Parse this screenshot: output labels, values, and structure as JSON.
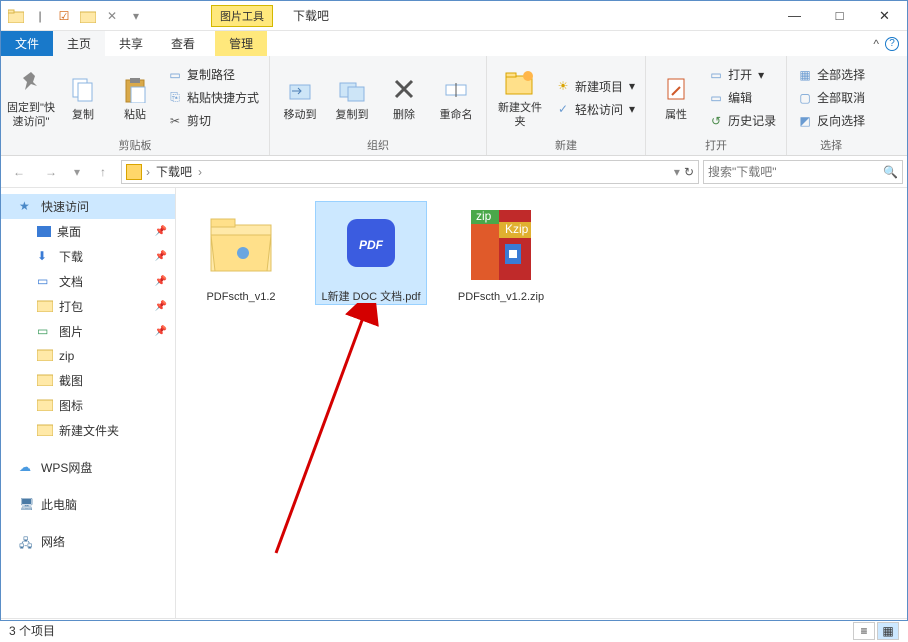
{
  "window": {
    "context_tab": "图片工具",
    "title": "下载吧",
    "minimize": "—",
    "maximize": "□",
    "close": "✕"
  },
  "tabs": {
    "file": "文件",
    "home": "主页",
    "share": "共享",
    "view": "查看",
    "manage": "管理"
  },
  "ribbon": {
    "clipboard": {
      "pin": "固定到\"快速访问\"",
      "copy": "复制",
      "paste": "粘贴",
      "copy_path": "复制路径",
      "paste_shortcut": "粘贴快捷方式",
      "cut": "剪切",
      "label": "剪贴板"
    },
    "organize": {
      "move_to": "移动到",
      "copy_to": "复制到",
      "delete": "删除",
      "rename": "重命名",
      "label": "组织"
    },
    "new": {
      "new_folder": "新建文件夹",
      "new_item": "新建项目",
      "easy_access": "轻松访问",
      "label": "新建"
    },
    "open": {
      "properties": "属性",
      "open": "打开",
      "edit": "编辑",
      "history": "历史记录",
      "label": "打开"
    },
    "select": {
      "select_all": "全部选择",
      "select_none": "全部取消",
      "invert": "反向选择",
      "label": "选择"
    }
  },
  "address": {
    "crumb1": "下载吧",
    "search_placeholder": "搜索\"下载吧\""
  },
  "sidebar": {
    "quick_access": "快速访问",
    "desktop": "桌面",
    "downloads": "下载",
    "documents": "文档",
    "dabao": "打包",
    "pictures": "图片",
    "zip": "zip",
    "jietu": "截图",
    "tubiao": "图标",
    "new_folder": "新建文件夹",
    "wps": "WPS网盘",
    "this_pc": "此电脑",
    "network": "网络"
  },
  "files": [
    {
      "name": "PDFscth_v1.2",
      "type": "folder"
    },
    {
      "name": "L新建 DOC 文档.pdf",
      "type": "pdf"
    },
    {
      "name": "PDFscth_v1.2.zip",
      "type": "zip"
    }
  ],
  "status": {
    "count": "3 个项目"
  }
}
